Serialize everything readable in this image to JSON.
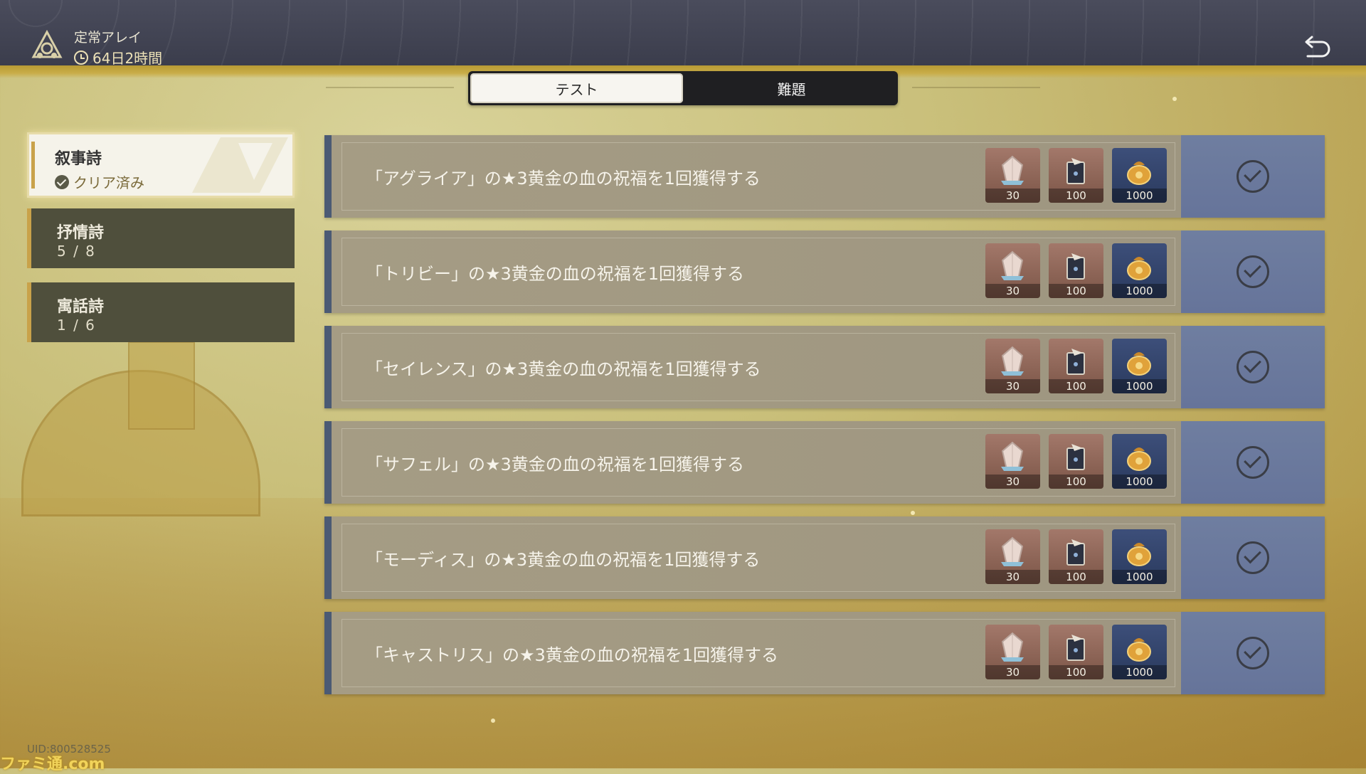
{
  "header": {
    "event_name": "定常アレイ",
    "timer": "64日2時間"
  },
  "tabs": [
    {
      "label": "テスト",
      "active": true
    },
    {
      "label": "難題",
      "active": false
    }
  ],
  "categories": [
    {
      "name": "叙事詩",
      "status": "クリア済み",
      "active": true
    },
    {
      "name": "抒情詩",
      "progress": "5 / 8",
      "active": false
    },
    {
      "name": "寓話詩",
      "progress": "1 / 6",
      "active": false
    }
  ],
  "tasks": [
    {
      "text": "「アグライア」の★3黄金の血の祝福を1回獲得する",
      "rewards": [
        "30",
        "100",
        "1000"
      ],
      "claimed": true
    },
    {
      "text": "「トリビー」の★3黄金の血の祝福を1回獲得する",
      "rewards": [
        "30",
        "100",
        "1000"
      ],
      "claimed": true
    },
    {
      "text": "「セイレンス」の★3黄金の血の祝福を1回獲得する",
      "rewards": [
        "30",
        "100",
        "1000"
      ],
      "claimed": true
    },
    {
      "text": "「サフェル」の★3黄金の血の祝福を1回獲得する",
      "rewards": [
        "30",
        "100",
        "1000"
      ],
      "claimed": true
    },
    {
      "text": "「モーディス」の★3黄金の血の祝福を1回獲得する",
      "rewards": [
        "30",
        "100",
        "1000"
      ],
      "claimed": true
    },
    {
      "text": "「キャストリス」の★3黄金の血の祝福を1回獲得する",
      "rewards": [
        "30",
        "100",
        "1000"
      ],
      "claimed": true
    }
  ],
  "reward_icons": [
    "crystal-icon",
    "book-icon",
    "credit-pouch-icon"
  ],
  "footer": {
    "uid": "UID:800528525",
    "watermark": "ファミ通.com"
  },
  "colors": {
    "accent_gold": "#c9a24a",
    "claim_bg": "#6f7ea0",
    "row_bg": "#a59c84"
  }
}
